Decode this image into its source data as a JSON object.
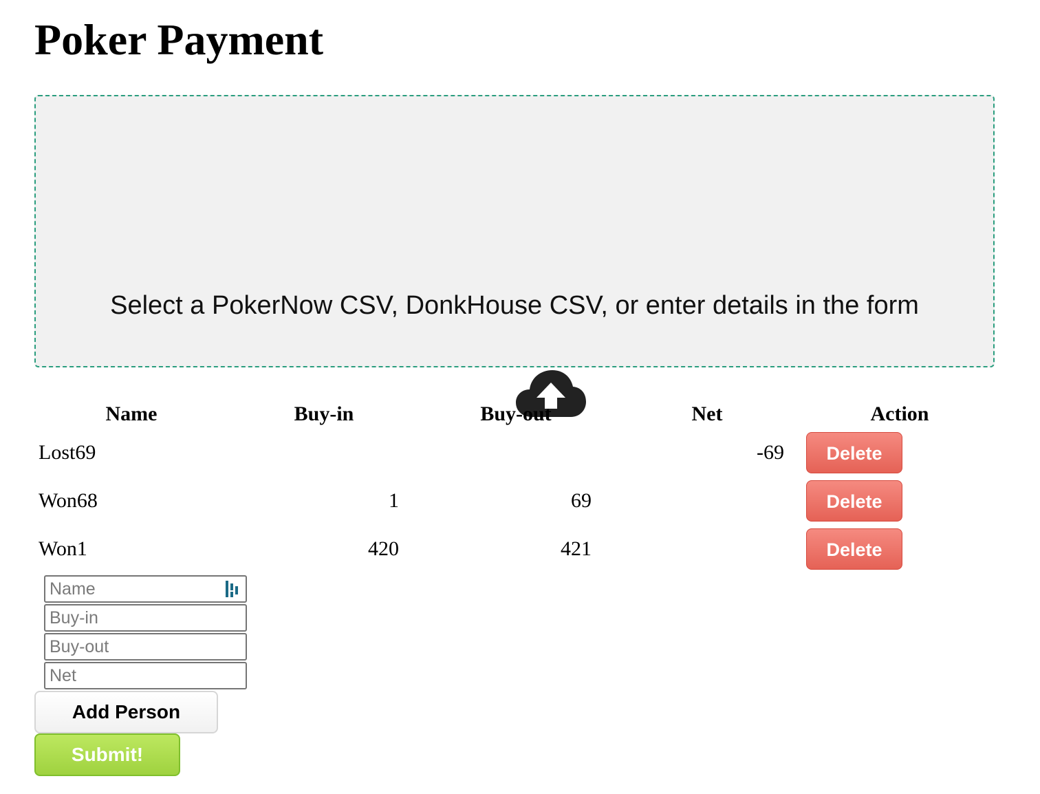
{
  "page": {
    "title": "Poker Payment"
  },
  "dropzone": {
    "text": "Select a PokerNow CSV, DonkHouse CSV, or enter details in the form",
    "icon": "cloud-upload-icon"
  },
  "table": {
    "headers": {
      "name": "Name",
      "buy_in": "Buy-in",
      "buy_out": "Buy-out",
      "net": "Net",
      "action": "Action"
    },
    "rows": [
      {
        "name": "Lost69",
        "buy_in": "",
        "buy_out": "",
        "net": "-69",
        "action": "Delete"
      },
      {
        "name": "Won68",
        "buy_in": "1",
        "buy_out": "69",
        "net": "",
        "action": "Delete"
      },
      {
        "name": "Won1",
        "buy_in": "420",
        "buy_out": "421",
        "net": "",
        "action": "Delete"
      }
    ]
  },
  "form": {
    "name_placeholder": "Name",
    "buy_in_placeholder": "Buy-in",
    "buy_out_placeholder": "Buy-out",
    "net_placeholder": "Net",
    "name_value": "",
    "buy_in_value": "",
    "buy_out_value": "",
    "net_value": "",
    "password_manager_icon": "password-manager-icon",
    "add_label": "Add Person",
    "submit_label": "Submit!"
  },
  "colors": {
    "dropzone_border": "#2a9d7e",
    "delete": "#e96c61",
    "submit": "#a8da48"
  }
}
